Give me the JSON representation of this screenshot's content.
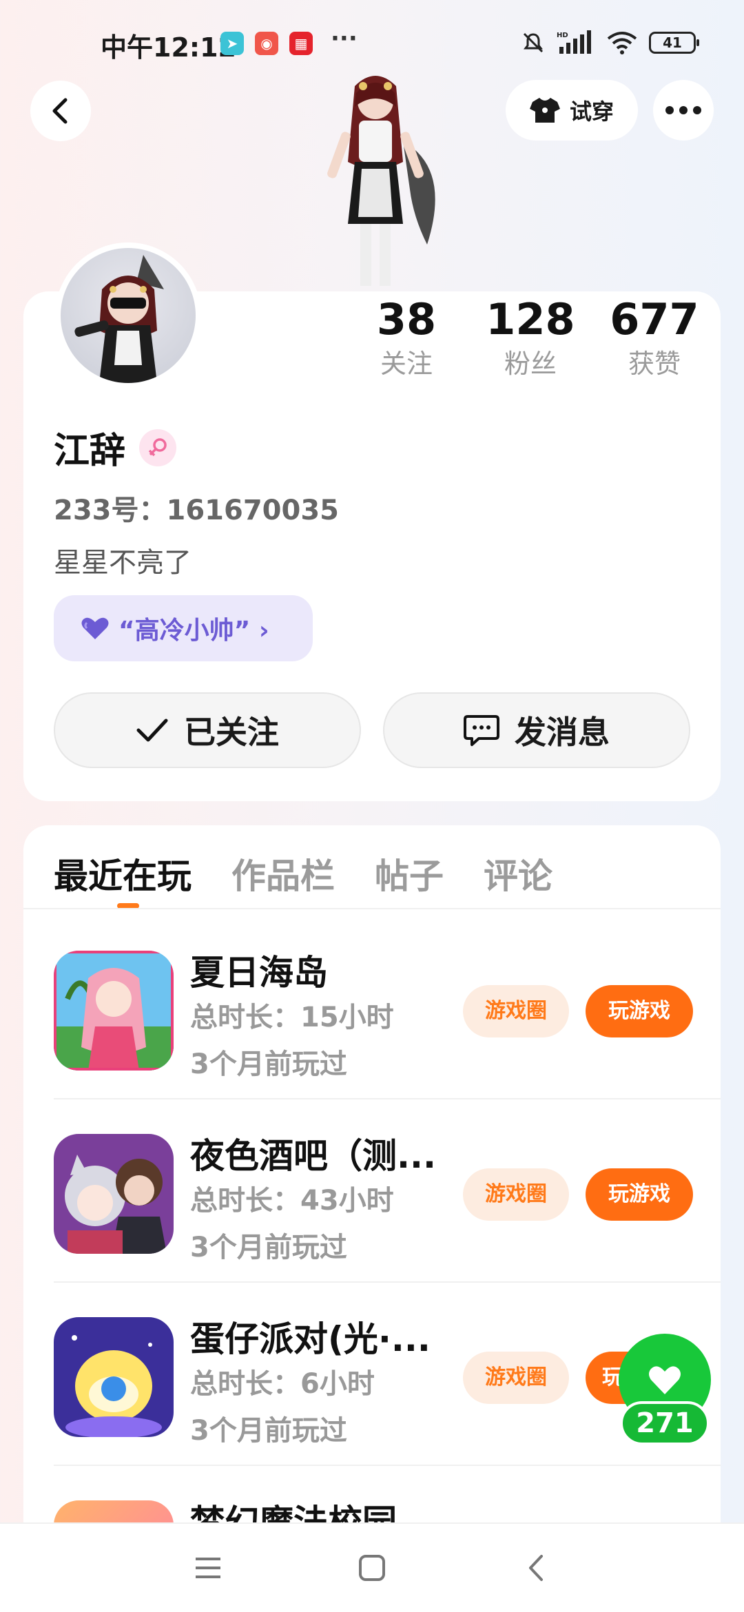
{
  "status_bar": {
    "time": "中午12:12",
    "more": "···",
    "battery": "41"
  },
  "header": {
    "try_on_label": "试穿"
  },
  "profile": {
    "stats": [
      {
        "value": "38",
        "label": "关注"
      },
      {
        "value": "128",
        "label": "粉丝"
      },
      {
        "value": "677",
        "label": "获赞"
      }
    ],
    "name": "江辞",
    "uid": "233号：161670035",
    "bio": "星星不亮了",
    "title_badge": "“高冷小帅” ›",
    "follow_button": "已关注",
    "message_button": "发消息"
  },
  "tabs": [
    {
      "label": "最近在玩",
      "active": true
    },
    {
      "label": "作品栏",
      "active": false
    },
    {
      "label": "帖子",
      "active": false
    },
    {
      "label": "评论",
      "active": false
    }
  ],
  "games": [
    {
      "name": "夏日海岛",
      "total_time": "总时长：15小时",
      "last_played": "3个月前玩过",
      "circle_label": "游戏圈",
      "play_label": "玩游戏"
    },
    {
      "name": "夜色酒吧（测...",
      "total_time": "总时长：43小时",
      "last_played": "3个月前玩过",
      "circle_label": "游戏圈",
      "play_label": "玩游戏"
    },
    {
      "name": "蛋仔派对(光·...",
      "total_time": "总时长：6小时",
      "last_played": "3个月前玩过",
      "circle_label": "游戏圈",
      "play_label": "玩"
    },
    {
      "name": "梦幻魔法校园",
      "total_time": "",
      "last_played": "",
      "circle_label": "",
      "play_label": ""
    }
  ],
  "like_float": {
    "count": "271"
  },
  "colors": {
    "accent_orange": "#ff6d12",
    "like_green": "#18c83a",
    "badge_purple": "#6c5bd4"
  }
}
